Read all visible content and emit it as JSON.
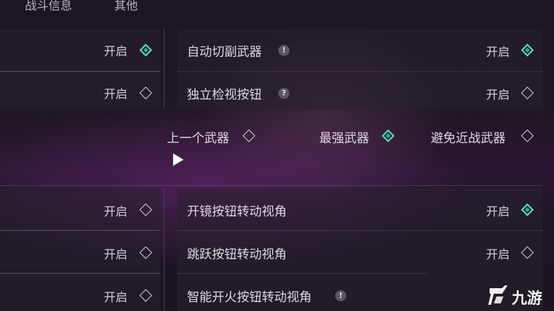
{
  "tabs": {
    "combat_info": "战斗信息",
    "other": "其他"
  },
  "top_section": {
    "left_rows": [
      {
        "value": "开启",
        "enabled": true
      },
      {
        "value": "开启",
        "enabled": false
      }
    ],
    "right_rows": [
      {
        "label": "自动切副武器",
        "badge": "!",
        "value": "开启",
        "enabled": true
      },
      {
        "label": "独立检视按钮",
        "badge": "?",
        "value": "开启",
        "enabled": false
      }
    ],
    "weapon_options": [
      {
        "label": "上一个武器",
        "selected": false
      },
      {
        "label": "最强武器",
        "selected": true
      },
      {
        "label": "避免近战武器",
        "selected": false
      }
    ]
  },
  "bottom_section": {
    "left_rows": [
      {
        "value": "开启",
        "enabled": false
      },
      {
        "value": "开启",
        "enabled": false
      },
      {
        "value": "开启",
        "enabled": false
      }
    ],
    "right_rows": [
      {
        "label": "开镜按钮转动视角",
        "value": "开启",
        "enabled": true
      },
      {
        "label": "跳跃按钮转动视角",
        "value": "开启",
        "enabled": false
      },
      {
        "label": "智能开火按钮转动视角",
        "badge": "!"
      }
    ]
  },
  "watermark": {
    "text": "九游",
    "icon": "jiuyou-logo-icon"
  },
  "colors": {
    "accent_teal": "#3aa391",
    "highlight_band": "#6e2878"
  }
}
